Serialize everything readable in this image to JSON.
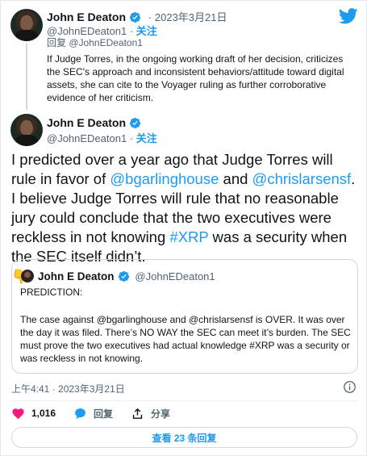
{
  "parent": {
    "name": "John E Deaton",
    "handle": "@JohnEDeaton1",
    "separator": " · ",
    "time": "2023年3月21日",
    "follow_label": "关注",
    "reply_to_label": "回复",
    "reply_to_handle": "@JohnEDeaton1",
    "text": "If Judge Torres, in the ongoing working draft of her decision, criticizes the SEC's approach and inconsistent behaviors/attitude toward digital assets, she can cite to the Voyager ruling as further corroborative evidence of her criticism."
  },
  "main": {
    "name": "John E Deaton",
    "handle": "@JohnEDeaton1",
    "separator": " · ",
    "follow_label": "关注",
    "text_1": "I predicted over a year ago that Judge Torres will rule in favor of ",
    "mention_1": "@bgarlinghouse",
    "text_2": " and ",
    "mention_2": "@chrislarsensf",
    "text_3": ". I believe Judge Torres will rule that no reasonable jury could conclude that the two executives were reckless in not knowing ",
    "hashtag": "#XRP",
    "text_4": " was a security when the SEC itself didn’t.",
    "emoji": "👇"
  },
  "quote": {
    "name": "John E Deaton",
    "handle": "@JohnEDeaton1",
    "heading": "PREDICTION:",
    "text": "The case against @bgarlinghouse and @chrislarsensf is OVER. It was over the day it was filed. There’s NO WAY the SEC can meet it’s burden. The SEC must prove the two executives had actual knowledge #XRP was a security or was reckless in not knowing."
  },
  "timestamp": "上午4:41 · 2023年3月21日",
  "actions": {
    "likes": "1,016",
    "reply_label": "回复",
    "share_label": "分享"
  },
  "replies_button": "查看 23 条回复",
  "colors": {
    "accent": "#1d9bf0",
    "like": "#f91880",
    "text_secondary": "#536471"
  }
}
